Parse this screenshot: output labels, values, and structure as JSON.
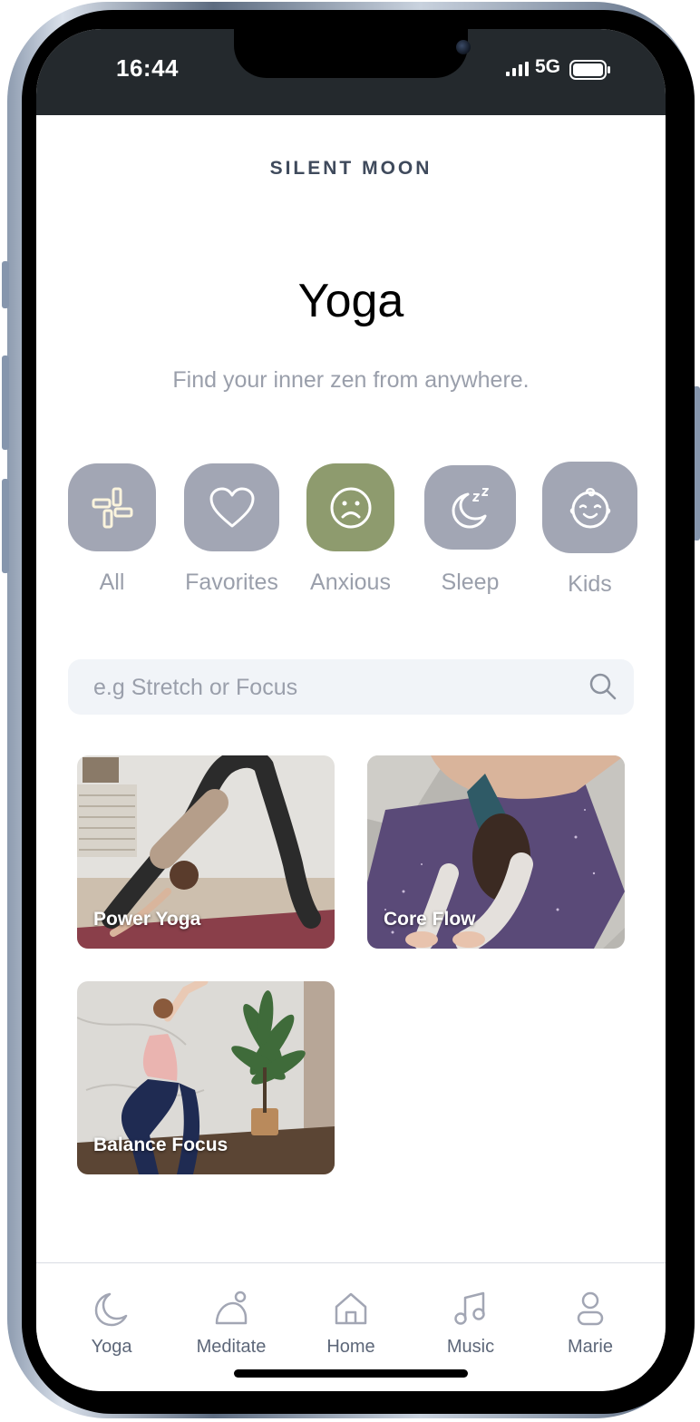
{
  "status_bar": {
    "time": "16:44",
    "network": "5G"
  },
  "header": {
    "brand": "SILENT MOON",
    "title": "Yoga",
    "subtitle": "Find your inner zen from anywhere."
  },
  "categories": [
    {
      "label": "All",
      "icon": "grid-icon",
      "active": false
    },
    {
      "label": "Favorites",
      "icon": "heart-icon",
      "active": false
    },
    {
      "label": "Anxious",
      "icon": "sad-face-icon",
      "active": true
    },
    {
      "label": "Sleep",
      "icon": "moon-zz-icon",
      "active": false
    },
    {
      "label": "Kids",
      "icon": "baby-face-icon",
      "active": false
    }
  ],
  "search": {
    "placeholder": "e.g Stretch or Focus",
    "value": ""
  },
  "cards": [
    {
      "label": "Power Yoga"
    },
    {
      "label": "Core Flow"
    },
    {
      "label": "Balance Focus"
    }
  ],
  "tabs": [
    {
      "label": "Yoga",
      "icon": "moon-icon"
    },
    {
      "label": "Meditate",
      "icon": "meditate-icon"
    },
    {
      "label": "Home",
      "icon": "home-icon"
    },
    {
      "label": "Music",
      "icon": "music-icon"
    },
    {
      "label": "Marie",
      "icon": "user-icon"
    }
  ],
  "colors": {
    "category_inactive": "#a2a6b4",
    "category_active": "#8e9b6e",
    "status_bar": "#24292d",
    "brand_text": "#3f4a5c",
    "muted_text": "#9a9fab"
  }
}
